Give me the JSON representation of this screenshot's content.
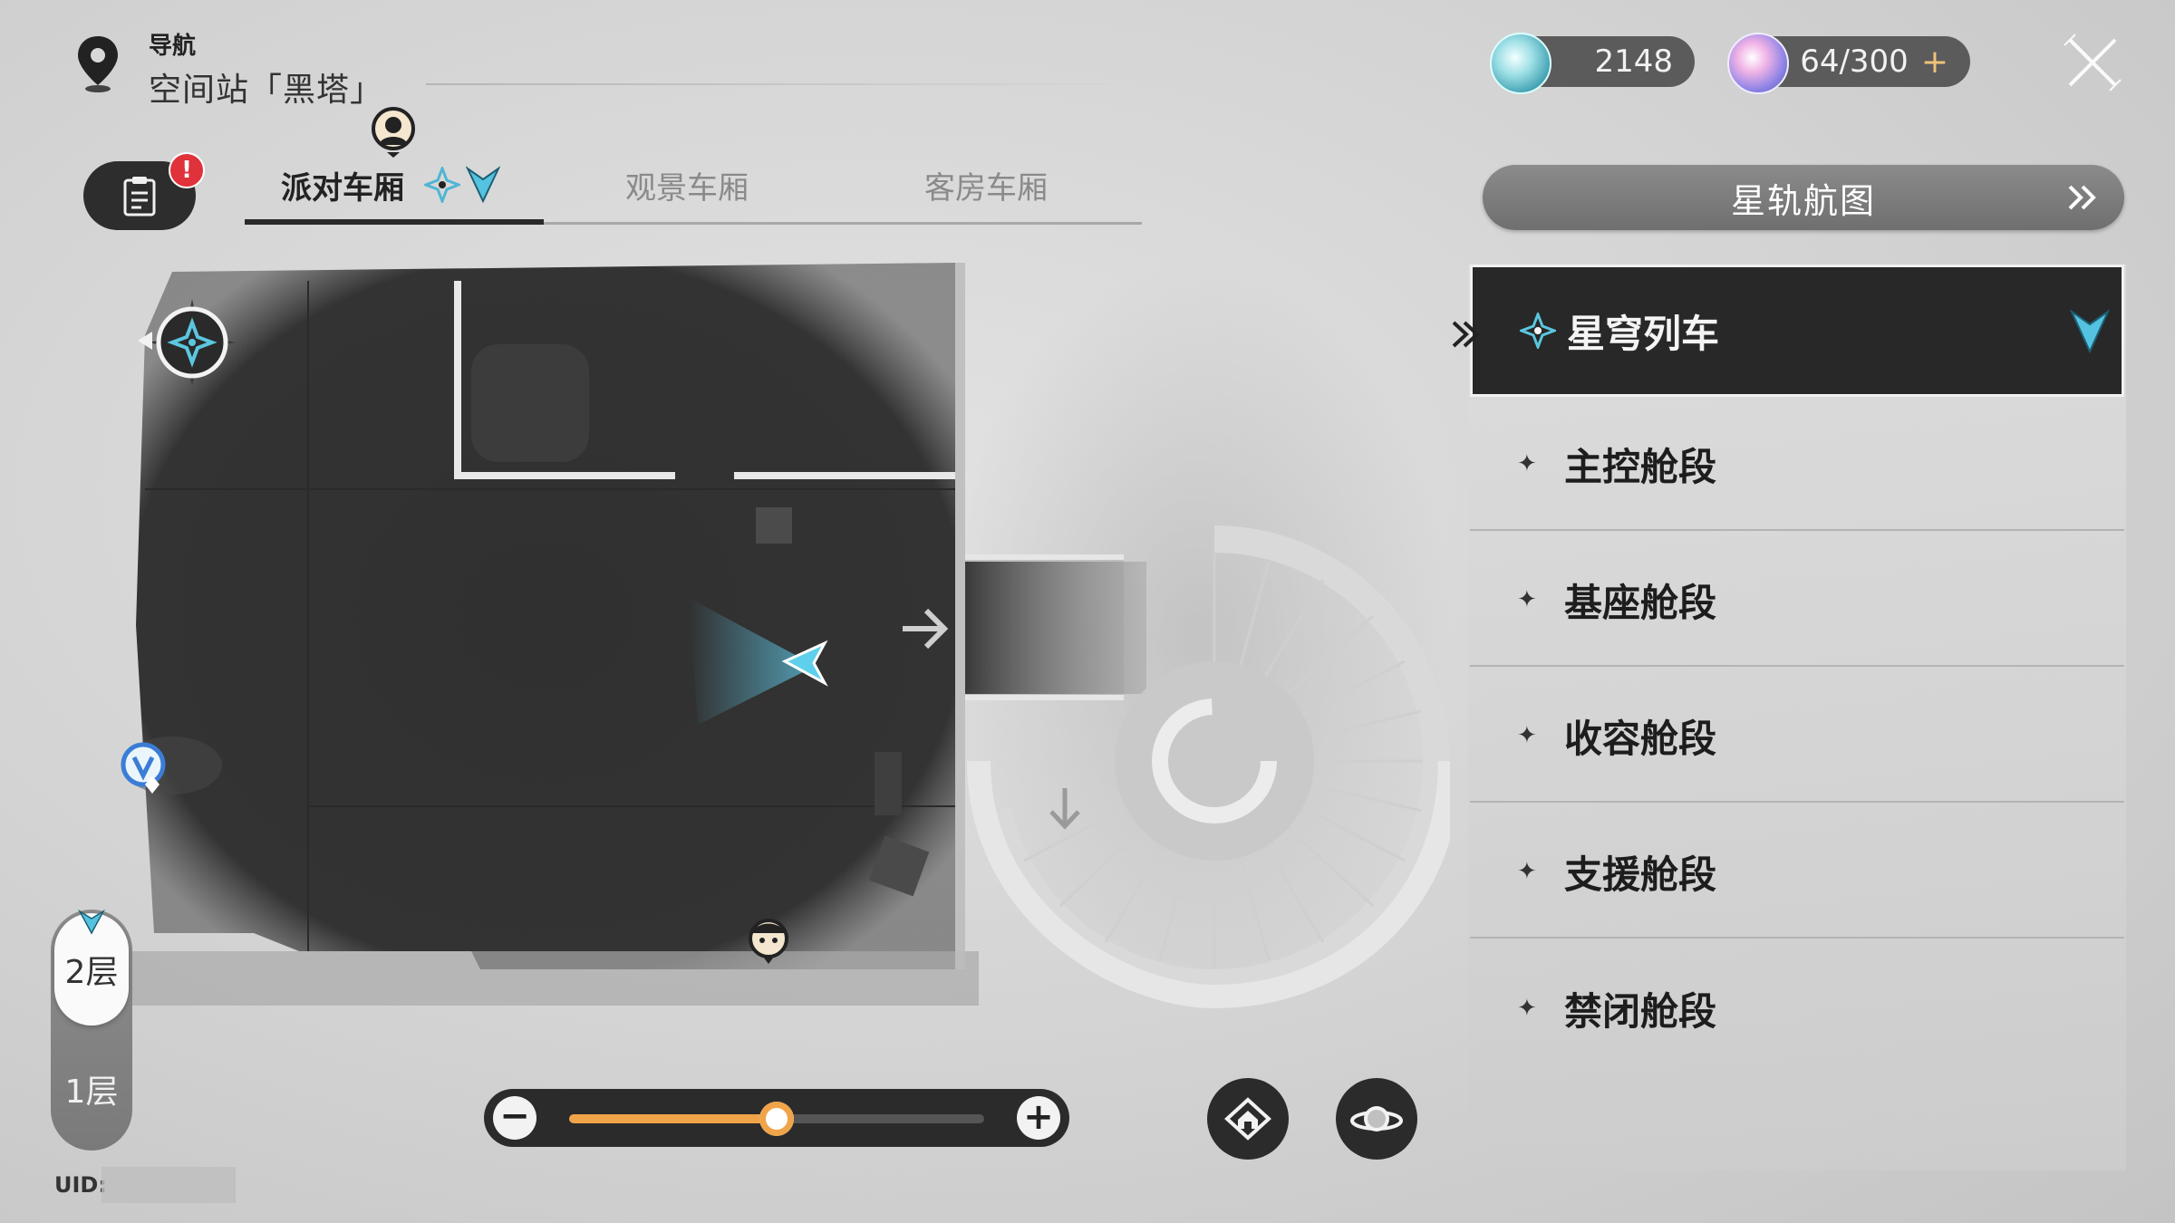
{
  "header": {
    "nav_label": "导航",
    "location": "空间站「黑塔」"
  },
  "currency": {
    "jade_value": "2148",
    "power_value": "64/300",
    "power_plus": "+"
  },
  "tabs": [
    {
      "label": "派对车厢",
      "active": true
    },
    {
      "label": "观景车厢",
      "active": false
    },
    {
      "label": "客房车厢",
      "active": false
    }
  ],
  "mission_badge": "!",
  "floors": [
    {
      "label": "2层",
      "active": true
    },
    {
      "label": "1层",
      "active": false
    }
  ],
  "uid_label": "UID:",
  "zoom": {
    "minus": "−",
    "plus": "+",
    "level": 0.5
  },
  "right_panel": {
    "starmap_label": "星轨航图",
    "items": [
      {
        "label": "星穹列车",
        "active": true
      },
      {
        "label": "主控舱段",
        "active": false
      },
      {
        "label": "基座舱段",
        "active": false
      },
      {
        "label": "收容舱段",
        "active": false
      },
      {
        "label": "支援舱段",
        "active": false
      },
      {
        "label": "禁闭舱段",
        "active": false
      }
    ]
  },
  "colors": {
    "accent_cyan": "#5ac7e0",
    "zoom_orange": "#f0a449",
    "alert_red": "#e0323a",
    "panel_dark": "#282828"
  }
}
